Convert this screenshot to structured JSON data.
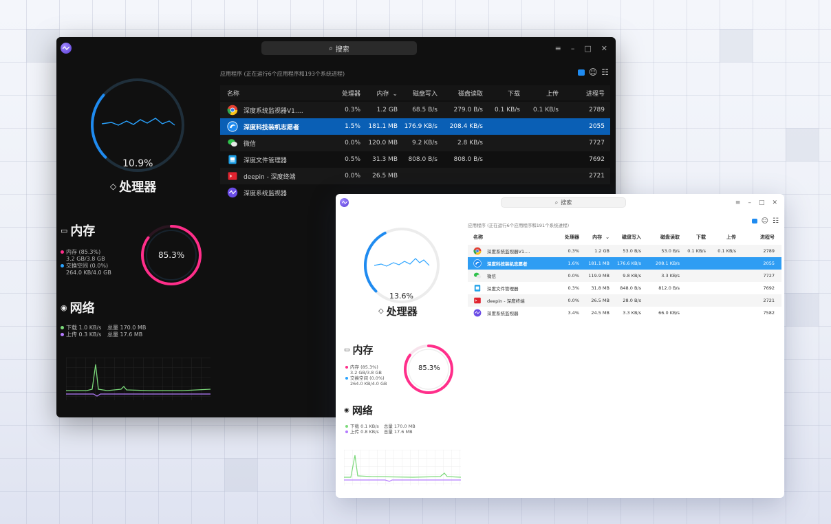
{
  "colors": {
    "accent_blue": "#1f8bf0",
    "memory_pink": "#ff2e8a",
    "swap_blue": "#2aa3ff",
    "download_green": "#7bd97a",
    "upload_purple": "#b57cff",
    "selected_dark": "#0a5fb5",
    "selected_light": "#2f9df3"
  },
  "dark": {
    "search_placeholder": "搜索",
    "caption": "应用程序 (正在运行6个应用程序和193个系统进程)",
    "cpu": {
      "percent_text": "10.9%",
      "percent": 10.9,
      "label": "处理器"
    },
    "memory": {
      "title": "内存",
      "percent_text": "85.3%",
      "percent": 85.3,
      "mem_line1": "内存 (85.3%)",
      "mem_line2": "3.2 GB/3.8 GB",
      "swap_line1": "交换空间 (0.0%)",
      "swap_line2": "264.0 KB/4.0 GB"
    },
    "network": {
      "title": "网络",
      "download": "下载 1.0 KB/s",
      "download_total": "总量 170.0 MB",
      "upload": "上传 0.3 KB/s",
      "upload_total": "总量 17.6 MB"
    },
    "columns": [
      "名称",
      "处理器",
      "内存",
      "磁盘写入",
      "磁盘读取",
      "下载",
      "上传",
      "进程号"
    ],
    "rows": [
      {
        "icon": "chrome-icon",
        "name": "深度系统监视器V1.…",
        "cpu": "0.3%",
        "mem": "1.2 GB",
        "dw": "68.5 B/s",
        "dr": "279.0 B/s",
        "down": "0.1 KB/s",
        "up": "0.1 KB/s",
        "pid": "2789"
      },
      {
        "icon": "deepin-icon",
        "name": "深度科技装机志愿者",
        "cpu": "1.5%",
        "mem": "181.1 MB",
        "dw": "176.9 KB/s",
        "dr": "208.4 KB/s",
        "down": "",
        "up": "",
        "pid": "2055"
      },
      {
        "icon": "wechat-icon",
        "name": "微信",
        "cpu": "0.0%",
        "mem": "120.0 MB",
        "dw": "9.2 KB/s",
        "dr": "2.8 KB/s",
        "down": "",
        "up": "",
        "pid": "7727"
      },
      {
        "icon": "file-manager-icon",
        "name": "深度文件管理器",
        "cpu": "0.5%",
        "mem": "31.3 MB",
        "dw": "808.0 B/s",
        "dr": "808.0 B/s",
        "down": "",
        "up": "",
        "pid": "7692"
      },
      {
        "icon": "terminal-icon",
        "name": "deepin - 深度终端",
        "cpu": "0.0%",
        "mem": "26.5 MB",
        "dw": "",
        "dr": "",
        "down": "",
        "up": "",
        "pid": "2721"
      },
      {
        "icon": "system-monitor-icon",
        "name": "深度系统监视器",
        "cpu": "",
        "mem": "",
        "dw": "",
        "dr": "",
        "down": "",
        "up": "",
        "pid": ""
      }
    ]
  },
  "light": {
    "search_placeholder": "搜索",
    "caption": "应用程序 (正在运行6个应用程序和191个系统进程)",
    "cpu": {
      "percent_text": "13.6%",
      "percent": 13.6,
      "label": "处理器"
    },
    "memory": {
      "title": "内存",
      "percent_text": "85.3%",
      "percent": 85.3,
      "mem_line1": "内存 (85.3%)",
      "mem_line2": "3.2 GB/3.8 GB",
      "swap_line1": "交换空间 (0.0%)",
      "swap_line2": "264.0 KB/4.0 GB"
    },
    "network": {
      "title": "网络",
      "download": "下载 0.1 KB/s",
      "download_total": "总量 170.0 MB",
      "upload": "上传 0.8 KB/s",
      "upload_total": "总量 17.6 MB"
    },
    "columns": [
      "名称",
      "处理器",
      "内存",
      "磁盘写入",
      "磁盘读取",
      "下载",
      "上传",
      "进程号"
    ],
    "rows": [
      {
        "icon": "chrome-icon",
        "name": "深度系统监视器V1.…",
        "cpu": "0.3%",
        "mem": "1.2 GB",
        "dw": "53.0 B/s",
        "dr": "53.0 B/s",
        "down": "0.1 KB/s",
        "up": "0.1 KB/s",
        "pid": "2789"
      },
      {
        "icon": "deepin-icon",
        "name": "深度科技装机志愿者",
        "cpu": "1.6%",
        "mem": "181.1 MB",
        "dw": "176.6 KB/s",
        "dr": "208.1 KB/s",
        "down": "",
        "up": "",
        "pid": "2055"
      },
      {
        "icon": "wechat-icon",
        "name": "微信",
        "cpu": "0.0%",
        "mem": "119.9 MB",
        "dw": "9.8 KB/s",
        "dr": "3.3 KB/s",
        "down": "",
        "up": "",
        "pid": "7727"
      },
      {
        "icon": "file-manager-icon",
        "name": "深度文件管理器",
        "cpu": "0.3%",
        "mem": "31.8 MB",
        "dw": "848.0 B/s",
        "dr": "812.0 B/s",
        "down": "",
        "up": "",
        "pid": "7692"
      },
      {
        "icon": "terminal-icon",
        "name": "deepin - 深度终端",
        "cpu": "0.0%",
        "mem": "26.5 MB",
        "dw": "28.0 B/s",
        "dr": "",
        "down": "",
        "up": "",
        "pid": "2721"
      },
      {
        "icon": "system-monitor-icon",
        "name": "深度系统监视器",
        "cpu": "3.4%",
        "mem": "24.5 MB",
        "dw": "3.3 KB/s",
        "dr": "66.0 KB/s",
        "down": "",
        "up": "",
        "pid": "7582"
      }
    ]
  }
}
